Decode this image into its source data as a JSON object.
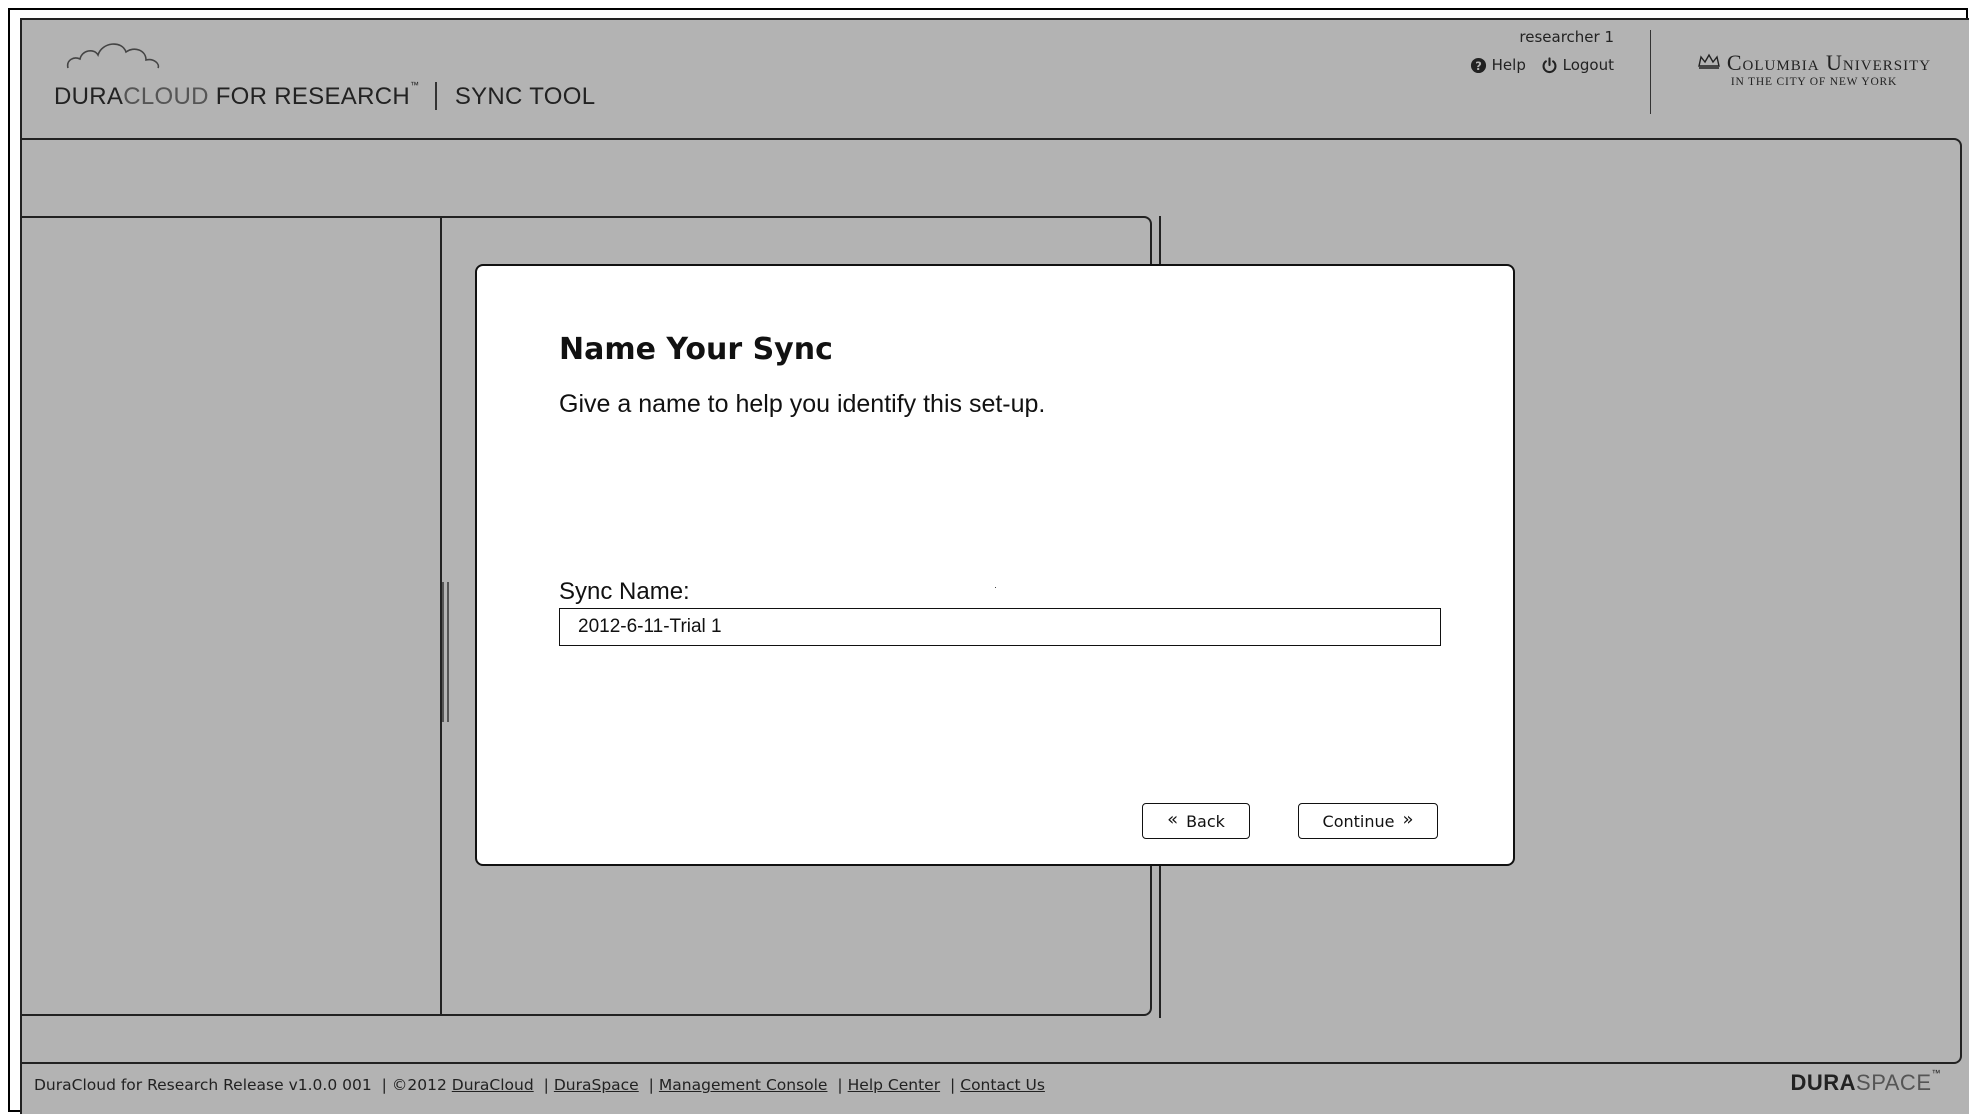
{
  "header": {
    "logo": {
      "dura": "DURA",
      "cloud": "CLOUD",
      "for_research": "FOR RESEARCH",
      "tm": "™",
      "product": "SYNC TOOL"
    },
    "user": "researcher 1",
    "help_label": "Help",
    "logout_label": "Logout",
    "institution": {
      "name": "Columbia University",
      "subtitle": "IN THE CITY OF NEW YORK"
    }
  },
  "modal": {
    "title": "Name Your Sync",
    "description": "Give a name to help you identify this set-up.",
    "field_label": "Sync Name:",
    "field_value": "2012-6-11-Trial 1",
    "back_label": "Back",
    "continue_label": "Continue"
  },
  "footer": {
    "release": "DuraCloud for Research Release v1.0.0 001",
    "copyright": "©2012",
    "links": [
      "DuraCloud",
      "DuraSpace",
      "Management Console",
      "Help Center",
      "Contact Us"
    ],
    "logo": {
      "dura": "DURA",
      "space": "SPACE",
      "tm": "™"
    }
  },
  "icons": {
    "help": "question-circle-icon",
    "logout": "power-icon",
    "crown": "crown-icon",
    "cloud": "cloud-icon",
    "back": "double-chevron-left-icon",
    "continue": "double-chevron-right-icon"
  },
  "colors": {
    "background": "#b3b3b3",
    "modal": "#ffffff",
    "text": "#111111"
  }
}
